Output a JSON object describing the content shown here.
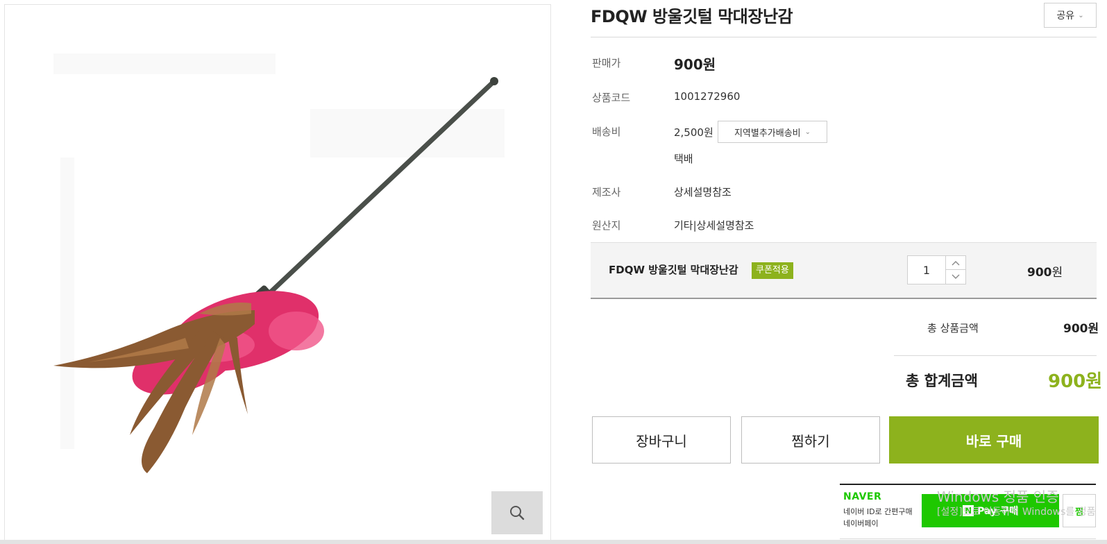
{
  "product": {
    "title": "FDQW 방울깃털 막대장난감",
    "share_label": "공유"
  },
  "info": {
    "price_label": "판매가",
    "price_value": "900원",
    "code_label": "상품코드",
    "code_value": "1001272960",
    "shipping_label": "배송비",
    "shipping_value": "2,500원",
    "shipping_select": "지역별추가배송비",
    "shipping_method": "택배",
    "maker_label": "제조사",
    "maker_value": "상세설명참조",
    "origin_label": "원산지",
    "origin_value": "기타|상세설명참조"
  },
  "option": {
    "name": "FDQW 방울깃털 막대장난감",
    "coupon_badge": "쿠폰적용",
    "quantity": "1",
    "price_number": "900",
    "price_unit": "원"
  },
  "totals": {
    "subtotal_label": "총 상품금액",
    "subtotal_value": "900원",
    "total_label": "총 합계금액",
    "total_value": "900원"
  },
  "buttons": {
    "cart": "장바구니",
    "wish": "찜하기",
    "buy": "바로 구매"
  },
  "naver": {
    "logo": "NAVER",
    "desc_1": "네이버 ID로 간편구매",
    "desc_2": "네이버페이",
    "pay_label": "Pay 구매",
    "pay_n": "N",
    "wish_label": "찜"
  },
  "watermark": {
    "line_1": "Windows 정품 인증",
    "line_2": "[설정]으로 이동하여 Windows를 정품"
  },
  "colors": {
    "accent": "#8db21d",
    "naver_green": "#1ec800"
  },
  "icons": {
    "zoom": "magnifier-icon",
    "share_chevron": "chevron-down-icon",
    "qty_up": "chevron-up-icon",
    "qty_down": "chevron-down-icon"
  }
}
